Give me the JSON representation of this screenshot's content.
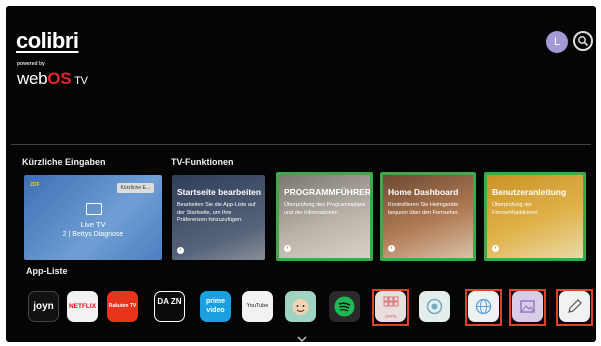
{
  "header": {
    "brand": "colibri",
    "powered_by": "powered by",
    "webos_web": "web",
    "webos_os": "OS",
    "webos_tv": "TV",
    "avatar_letter": "L"
  },
  "recent_inputs": {
    "title": "Kürzliche Eingaben",
    "card": {
      "logo": "ZDF",
      "badge": "Kürzliche E...",
      "line1": "Live TV",
      "line2": "2 | Bettys Diagnose"
    }
  },
  "tv_functions": {
    "title": "TV-Funktionen",
    "cards": [
      {
        "title": "Startseite bearbeiten",
        "desc": "Bearbeiten Sie die App-Liste auf der Startseite, um Ihre Präferenzen hinzuzufügen.",
        "color": "#2f3d58"
      },
      {
        "title": "PROGRAMMFÜHRER",
        "desc": "Überprüfung des Programmplans und der Informationen",
        "color": "#b9b2a8"
      },
      {
        "title": "Home Dashboard",
        "desc": "Kontrollieren Sie Heimgeräte bequem über den Fernseher.",
        "color": "#b07a54"
      },
      {
        "title": "Benutzeranleitung",
        "desc": "Überprüfung der Fernsehfunktionen",
        "color": "#d6a63a"
      }
    ]
  },
  "app_list": {
    "title": "App-Liste",
    "apps": [
      {
        "name": "joyn",
        "label": "joyn"
      },
      {
        "name": "netflix",
        "label": "NETFLIX"
      },
      {
        "name": "rakuten",
        "label": "Rakuten TV"
      },
      {
        "name": "dazn",
        "label": "DA ZN"
      },
      {
        "name": "prime",
        "label": "prime video"
      },
      {
        "name": "youtube",
        "label": "YouTube"
      },
      {
        "name": "kids",
        "label": ""
      },
      {
        "name": "spotify",
        "label": ""
      },
      {
        "name": "apps",
        "label": "APPS"
      },
      {
        "name": "camera",
        "label": ""
      },
      {
        "name": "browser",
        "label": ""
      },
      {
        "name": "gallery",
        "label": ""
      },
      {
        "name": "edit",
        "label": ""
      }
    ]
  },
  "colors": {
    "highlight_green": "#3ea84a",
    "highlight_red": "#e3402b",
    "avatar": "#a39ad6"
  }
}
